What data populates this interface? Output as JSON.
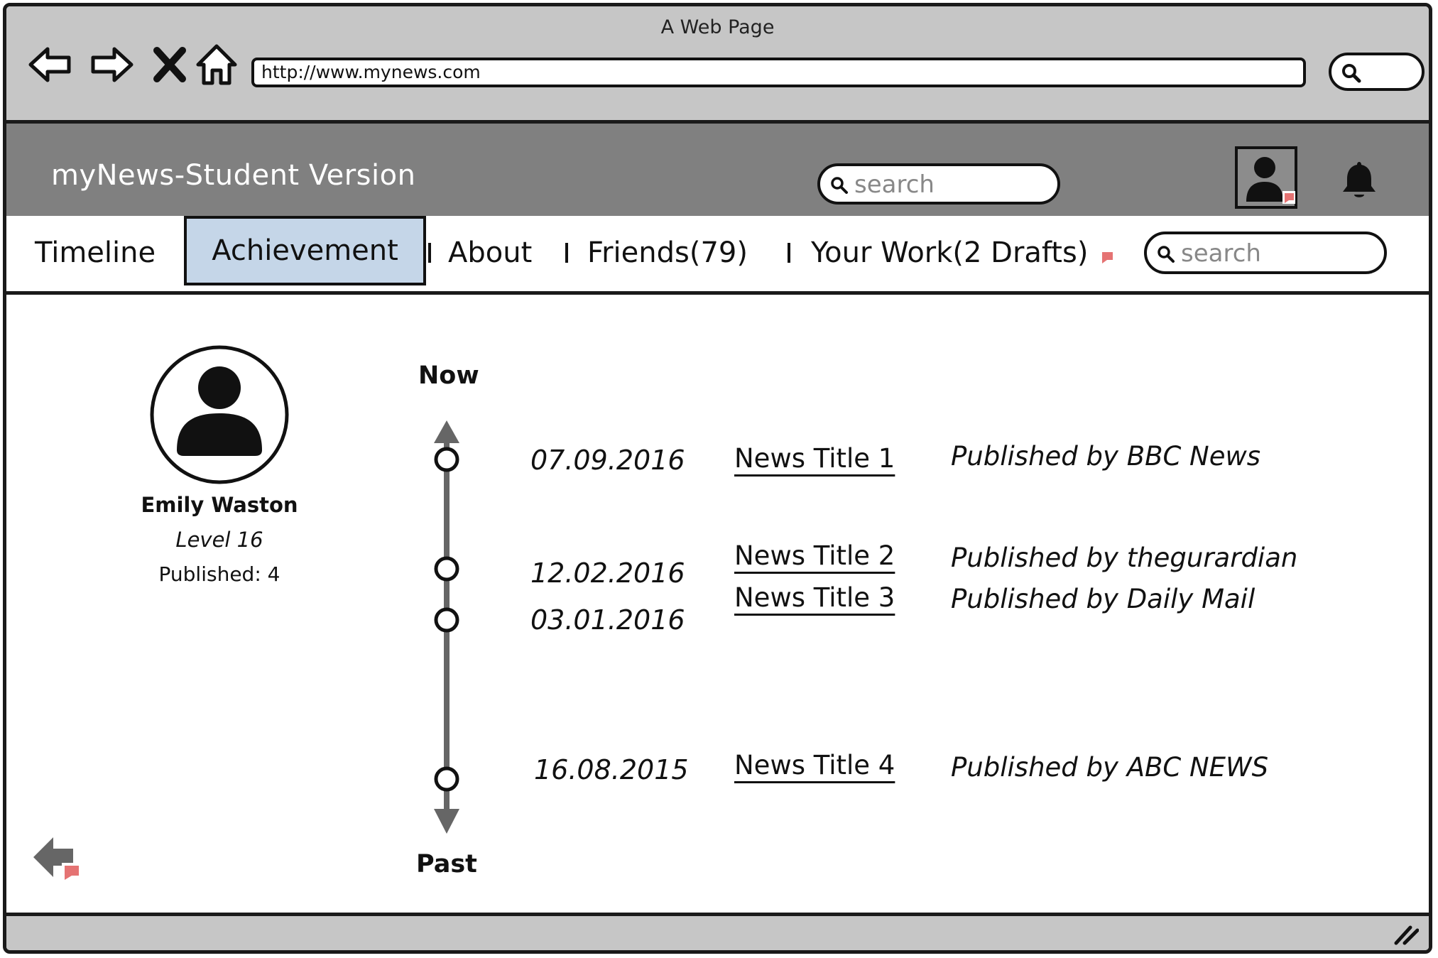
{
  "window": {
    "title": "A Web Page"
  },
  "browser": {
    "url": "http://www.mynews.com"
  },
  "app": {
    "title": "myNews-Student Version",
    "search_placeholder": "search"
  },
  "tabs": {
    "timeline": "Timeline",
    "achievement": "Achievement",
    "about": "About",
    "friends": "Friends(79)",
    "your_work": "Your Work(2 Drafts)",
    "search_placeholder": "search"
  },
  "profile": {
    "name": "Emily Waston",
    "level": "Level 16",
    "published": "Published: 4"
  },
  "timeline": {
    "top_label": "Now",
    "bottom_label": "Past",
    "entries": [
      {
        "date": "07.09.2016",
        "title": "News Title 1",
        "publisher": "Published by BBC News"
      },
      {
        "date": "12.02.2016",
        "title": "News Title 2",
        "publisher": "Published by thegurardian"
      },
      {
        "date": "03.01.2016",
        "title": "News Title 3",
        "publisher": "Published by Daily Mail"
      },
      {
        "date": "16.08.2015",
        "title": "News Title 4",
        "publisher": "Published by ABC NEWS"
      }
    ]
  },
  "icons": {
    "back": "arrow-left-icon",
    "forward": "arrow-right-icon",
    "stop": "close-icon",
    "home": "home-icon",
    "search": "search-icon",
    "user": "user-icon",
    "notifications": "bell-icon",
    "link_marker": "link-flag-icon",
    "resize": "resize-grip-icon"
  },
  "colors": {
    "header_bg": "#808080",
    "chrome_bg": "#c6c6c6",
    "active_tab_bg": "#c5d6e8",
    "link_flag": "#e57373"
  }
}
